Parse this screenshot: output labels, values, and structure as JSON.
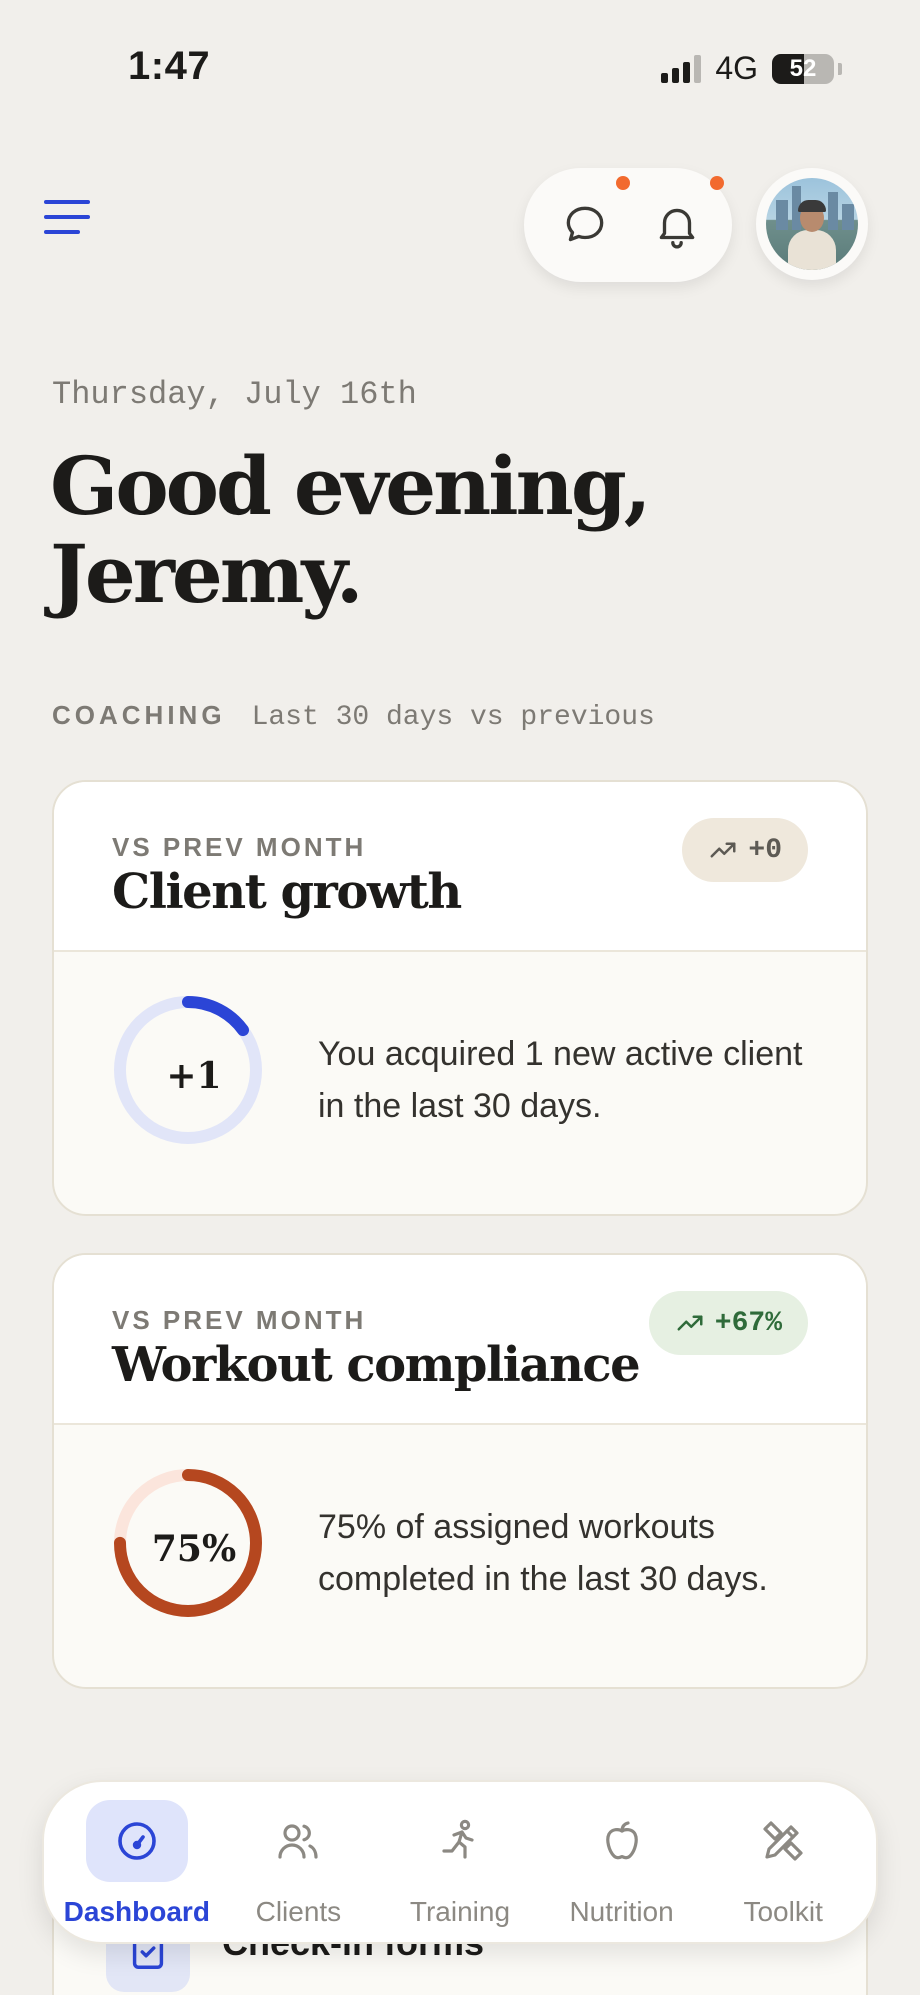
{
  "status_bar": {
    "time": "1:47",
    "network": "4G",
    "battery": "52"
  },
  "header": {
    "menu_icon": "hamburger-menu-icon",
    "chat_icon": "chat-bubble-icon",
    "bell_icon": "bell-icon",
    "has_chat_notification": true,
    "has_bell_notification": true
  },
  "greeting": {
    "date": "Thursday, July 16th",
    "line1": "Good evening,",
    "line2": "Jeremy."
  },
  "section": {
    "label": "COACHING",
    "subtitle": "Last 30 days vs previous"
  },
  "cards": [
    {
      "kicker": "VS PREV MONTH",
      "title": "Client growth",
      "badge": "+0",
      "badge_tone": "neutral",
      "ring_value": "+1",
      "ring_fraction": 0.15,
      "description": "You acquired 1 new active client in the last 30 days."
    },
    {
      "kicker": "VS PREV MONTH",
      "title": "Workout compliance",
      "badge": "+67%",
      "badge_tone": "positive",
      "ring_value": "75%",
      "ring_fraction": 0.75,
      "description": "75% of assigned workouts completed in the last 30 days."
    }
  ],
  "peek_card": {
    "title": "Check-in forms",
    "icon": "clipboard-check-icon"
  },
  "tab_bar": {
    "active": "Dashboard",
    "tabs": [
      {
        "label": "Dashboard",
        "icon": "gauge-icon"
      },
      {
        "label": "Clients",
        "icon": "users-icon"
      },
      {
        "label": "Training",
        "icon": "running-person-icon"
      },
      {
        "label": "Nutrition",
        "icon": "apple-icon"
      },
      {
        "label": "Toolkit",
        "icon": "pencil-ruler-icon"
      }
    ]
  },
  "colors": {
    "accent": "#2b45d6",
    "ring_blue": "#2b45d6",
    "ring_blue_track": "#e1e5f8",
    "ring_orange": "#b5471f",
    "ring_orange_track": "#fbe5dc",
    "notification": "#f26a2e"
  }
}
